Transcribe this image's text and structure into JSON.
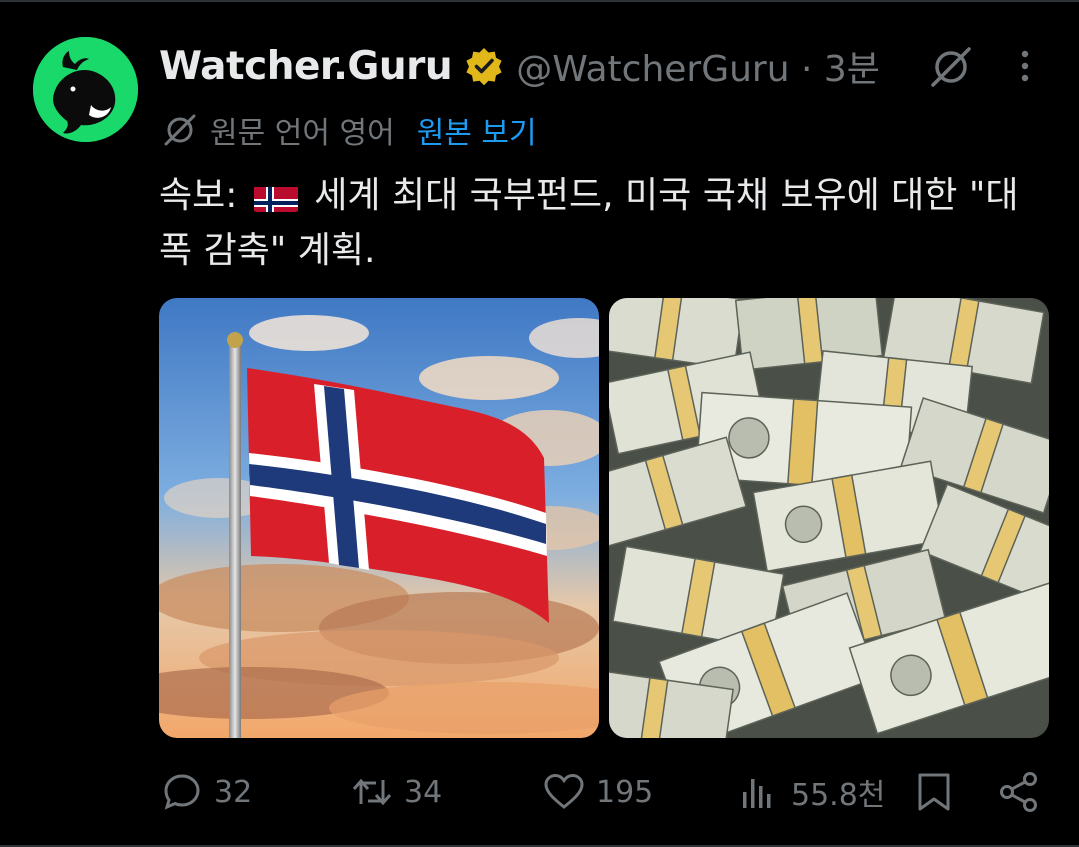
{
  "post": {
    "author_name": "Watcher.Guru",
    "handle_time": "@WatcherGuru · 3분",
    "translation_label": "원문 언어 영어",
    "show_original_link": "원본 보기",
    "text_prefix": "속보:",
    "text_body": "세계 최대 국부펀드, 미국 국채 보유에 대한 \"대폭 감축\" 계획."
  },
  "actions": {
    "replies": "32",
    "reposts": "34",
    "likes": "195",
    "views": "55.8천"
  },
  "icons": {
    "avatar": "whale-logo",
    "verified": "verified-badge-icon",
    "grok": "grok-icon",
    "more": "more-vertical-icon",
    "translate": "translate-icon",
    "reply": "reply-icon",
    "repost": "repost-icon",
    "like": "heart-icon",
    "views": "analytics-icon",
    "bookmark": "bookmark-icon",
    "share": "share-icon"
  },
  "colors": {
    "background": "#000000",
    "text": "#e7e9ea",
    "muted": "#71767b",
    "link": "#1d9bf0",
    "verified_badge": "#e2b719",
    "avatar_bg": "#19d96a"
  }
}
